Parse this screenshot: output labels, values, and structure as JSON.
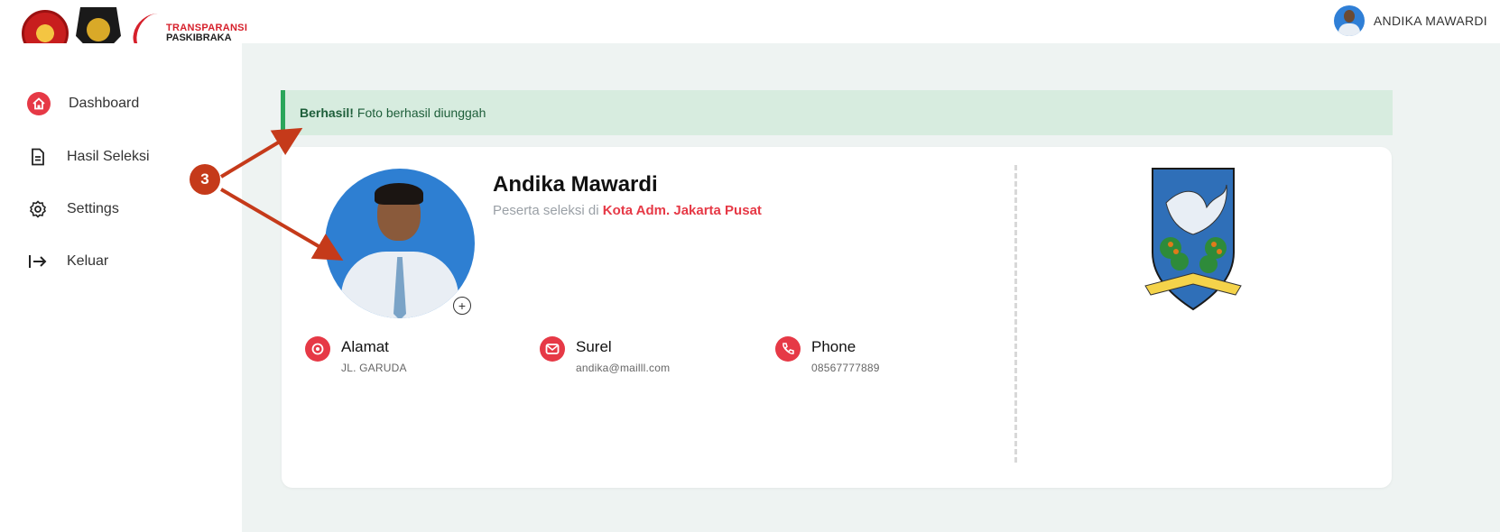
{
  "header": {
    "logo_text_line1": "TRANSPARANSI",
    "logo_text_line2": "PASKIBRAKA",
    "user_name": "ANDIKA MAWARDI"
  },
  "sidebar": {
    "items": [
      {
        "label": "Dashboard",
        "icon": "home-icon",
        "active": true
      },
      {
        "label": "Hasil Seleksi",
        "icon": "document-icon",
        "active": false
      },
      {
        "label": "Settings",
        "icon": "gear-icon",
        "active": false
      },
      {
        "label": "Keluar",
        "icon": "logout-icon",
        "active": false
      }
    ]
  },
  "alert": {
    "title": "Berhasil!",
    "message": "Foto berhasil diunggah"
  },
  "profile": {
    "name": "Andika Mawardi",
    "subtitle_prefix": "Peserta seleksi di",
    "region": "Kota Adm. Jakarta Pusat",
    "contacts": [
      {
        "title": "Alamat",
        "value": "JL. GARUDA",
        "icon": "location-pin-icon"
      },
      {
        "title": "Surel",
        "value": "andika@mailll.com",
        "icon": "mail-icon"
      },
      {
        "title": "Phone",
        "value": "08567777889",
        "icon": "phone-icon"
      }
    ]
  },
  "annotation": {
    "badge": "3"
  },
  "colors": {
    "accent": "#e63946",
    "alert_bg": "#d7ecdf",
    "alert_border": "#2aa65a",
    "main_bg": "#eef3f2",
    "annotation": "#c53a1a"
  }
}
